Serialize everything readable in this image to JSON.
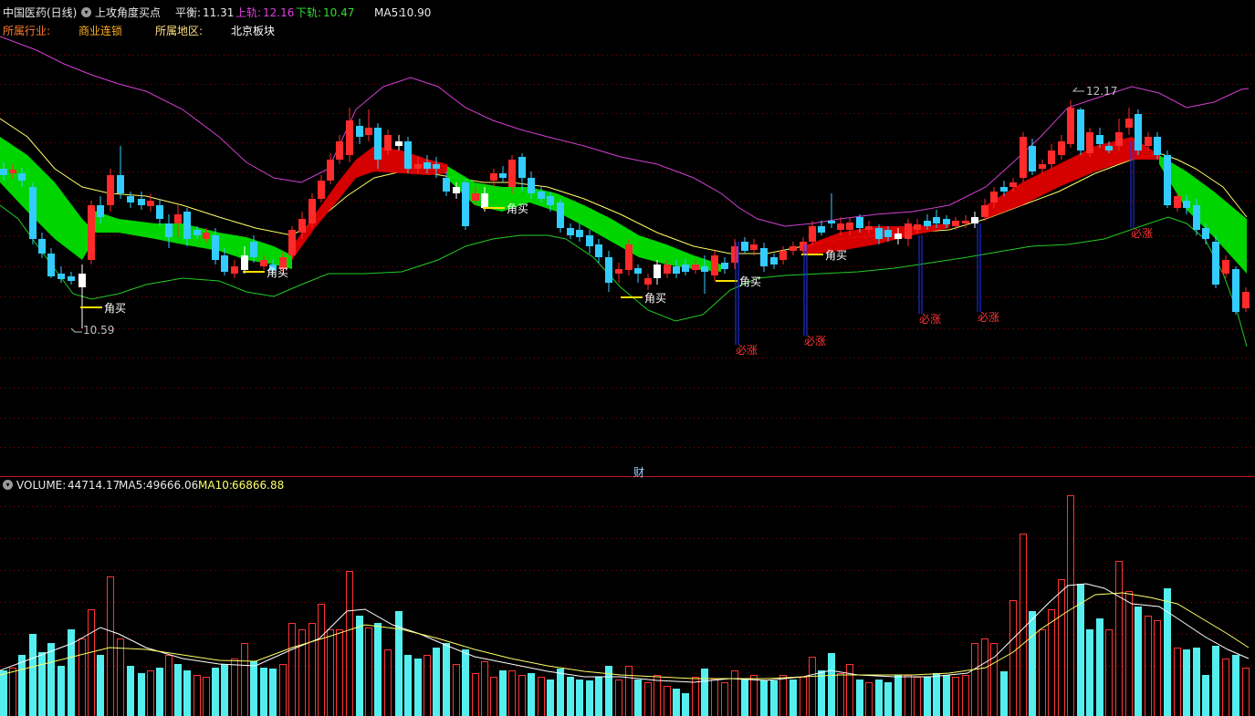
{
  "header": {
    "stock_name": "中国医药(日线)",
    "indicator_name": "上攻角度买点",
    "stats": [
      {
        "label": "平衡:",
        "value": "11.31",
        "color": "#ffffff"
      },
      {
        "label": "上轨:",
        "value": "12.16",
        "color": "#e040e0"
      },
      {
        "label": "下轨:",
        "value": "10.47",
        "color": "#33dd33"
      },
      {
        "label": "MA5:",
        "value": "10.90",
        "color": "#ffffff"
      }
    ],
    "industry_label": "所属行业:",
    "industry_value": "商业连锁",
    "region_label": "所属地区:",
    "region_value": "北京板块"
  },
  "divider_label": "财",
  "volume_header": {
    "volume_label": "VOLUME:",
    "volume_value": "44714.17",
    "ma5_label": "MA5:",
    "ma5_value": "49666.06",
    "ma10_label": "MA10:",
    "ma10_value": "66866.88"
  },
  "annotations": {
    "high_label": "12.17",
    "low_label": "10.59",
    "buy_signal": "角买",
    "rise_signal": "必涨"
  },
  "colors": {
    "up": "#ff2a2a",
    "down": "#33ccff",
    "flat": "#ffffff",
    "upper_band": "#d040d0",
    "lower_band": "#22cc22",
    "mid": "#ffff66",
    "ribbon_up": "#e00000",
    "ribbon_down": "#00e000",
    "vol_up": "#ff3333",
    "vol_down": "#55eeee",
    "vol_ma5": "#ffffff",
    "vol_ma10": "#ffff66",
    "grid": "#8a0000",
    "separator": "#c0161b"
  },
  "chart_data": {
    "type": "candlestick",
    "price_axis_anchor": {
      "high": 12.17,
      "low": 10.59
    },
    "bands": {
      "mid": 11.31,
      "upper": 12.16,
      "lower": 10.47,
      "ma5": 10.9
    },
    "volume": {
      "last": 44714.17,
      "ma5": 49666.06,
      "ma10": 66866.88
    }
  }
}
